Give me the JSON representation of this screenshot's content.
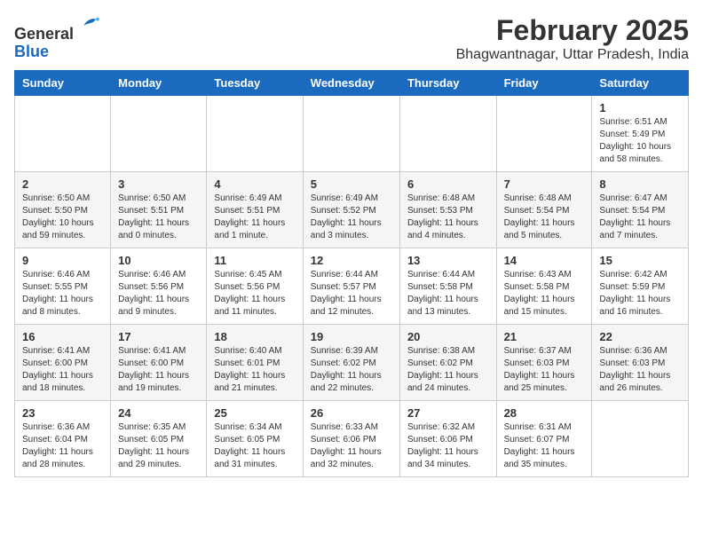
{
  "header": {
    "logo_line1": "General",
    "logo_line2": "Blue",
    "main_title": "February 2025",
    "subtitle": "Bhagwantnagar, Uttar Pradesh, India"
  },
  "weekdays": [
    "Sunday",
    "Monday",
    "Tuesday",
    "Wednesday",
    "Thursday",
    "Friday",
    "Saturday"
  ],
  "weeks": [
    [
      {
        "day": "",
        "info": ""
      },
      {
        "day": "",
        "info": ""
      },
      {
        "day": "",
        "info": ""
      },
      {
        "day": "",
        "info": ""
      },
      {
        "day": "",
        "info": ""
      },
      {
        "day": "",
        "info": ""
      },
      {
        "day": "1",
        "info": "Sunrise: 6:51 AM\nSunset: 5:49 PM\nDaylight: 10 hours\nand 58 minutes."
      }
    ],
    [
      {
        "day": "2",
        "info": "Sunrise: 6:50 AM\nSunset: 5:50 PM\nDaylight: 10 hours\nand 59 minutes."
      },
      {
        "day": "3",
        "info": "Sunrise: 6:50 AM\nSunset: 5:51 PM\nDaylight: 11 hours\nand 0 minutes."
      },
      {
        "day": "4",
        "info": "Sunrise: 6:49 AM\nSunset: 5:51 PM\nDaylight: 11 hours\nand 1 minute."
      },
      {
        "day": "5",
        "info": "Sunrise: 6:49 AM\nSunset: 5:52 PM\nDaylight: 11 hours\nand 3 minutes."
      },
      {
        "day": "6",
        "info": "Sunrise: 6:48 AM\nSunset: 5:53 PM\nDaylight: 11 hours\nand 4 minutes."
      },
      {
        "day": "7",
        "info": "Sunrise: 6:48 AM\nSunset: 5:54 PM\nDaylight: 11 hours\nand 5 minutes."
      },
      {
        "day": "8",
        "info": "Sunrise: 6:47 AM\nSunset: 5:54 PM\nDaylight: 11 hours\nand 7 minutes."
      }
    ],
    [
      {
        "day": "9",
        "info": "Sunrise: 6:46 AM\nSunset: 5:55 PM\nDaylight: 11 hours\nand 8 minutes."
      },
      {
        "day": "10",
        "info": "Sunrise: 6:46 AM\nSunset: 5:56 PM\nDaylight: 11 hours\nand 9 minutes."
      },
      {
        "day": "11",
        "info": "Sunrise: 6:45 AM\nSunset: 5:56 PM\nDaylight: 11 hours\nand 11 minutes."
      },
      {
        "day": "12",
        "info": "Sunrise: 6:44 AM\nSunset: 5:57 PM\nDaylight: 11 hours\nand 12 minutes."
      },
      {
        "day": "13",
        "info": "Sunrise: 6:44 AM\nSunset: 5:58 PM\nDaylight: 11 hours\nand 13 minutes."
      },
      {
        "day": "14",
        "info": "Sunrise: 6:43 AM\nSunset: 5:58 PM\nDaylight: 11 hours\nand 15 minutes."
      },
      {
        "day": "15",
        "info": "Sunrise: 6:42 AM\nSunset: 5:59 PM\nDaylight: 11 hours\nand 16 minutes."
      }
    ],
    [
      {
        "day": "16",
        "info": "Sunrise: 6:41 AM\nSunset: 6:00 PM\nDaylight: 11 hours\nand 18 minutes."
      },
      {
        "day": "17",
        "info": "Sunrise: 6:41 AM\nSunset: 6:00 PM\nDaylight: 11 hours\nand 19 minutes."
      },
      {
        "day": "18",
        "info": "Sunrise: 6:40 AM\nSunset: 6:01 PM\nDaylight: 11 hours\nand 21 minutes."
      },
      {
        "day": "19",
        "info": "Sunrise: 6:39 AM\nSunset: 6:02 PM\nDaylight: 11 hours\nand 22 minutes."
      },
      {
        "day": "20",
        "info": "Sunrise: 6:38 AM\nSunset: 6:02 PM\nDaylight: 11 hours\nand 24 minutes."
      },
      {
        "day": "21",
        "info": "Sunrise: 6:37 AM\nSunset: 6:03 PM\nDaylight: 11 hours\nand 25 minutes."
      },
      {
        "day": "22",
        "info": "Sunrise: 6:36 AM\nSunset: 6:03 PM\nDaylight: 11 hours\nand 26 minutes."
      }
    ],
    [
      {
        "day": "23",
        "info": "Sunrise: 6:36 AM\nSunset: 6:04 PM\nDaylight: 11 hours\nand 28 minutes."
      },
      {
        "day": "24",
        "info": "Sunrise: 6:35 AM\nSunset: 6:05 PM\nDaylight: 11 hours\nand 29 minutes."
      },
      {
        "day": "25",
        "info": "Sunrise: 6:34 AM\nSunset: 6:05 PM\nDaylight: 11 hours\nand 31 minutes."
      },
      {
        "day": "26",
        "info": "Sunrise: 6:33 AM\nSunset: 6:06 PM\nDaylight: 11 hours\nand 32 minutes."
      },
      {
        "day": "27",
        "info": "Sunrise: 6:32 AM\nSunset: 6:06 PM\nDaylight: 11 hours\nand 34 minutes."
      },
      {
        "day": "28",
        "info": "Sunrise: 6:31 AM\nSunset: 6:07 PM\nDaylight: 11 hours\nand 35 minutes."
      },
      {
        "day": "",
        "info": ""
      }
    ]
  ]
}
